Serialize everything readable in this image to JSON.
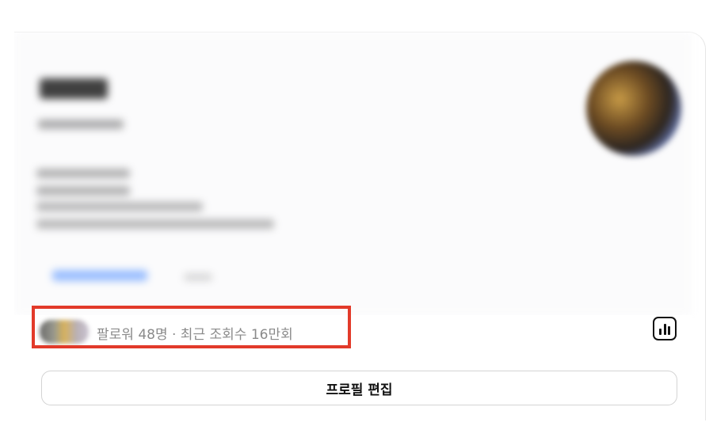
{
  "profile": {
    "stats_text": "팔로워 48명 · 최근 조회수 16만회",
    "edit_button_label": "프로필 편집"
  },
  "icons": {
    "insights": "bar-chart-icon",
    "follower_avatars": "follower-avatar-stack"
  },
  "colors": {
    "highlight": "#e23a2a",
    "stats_text": "#8a8a8a",
    "button_border": "#d4d4d4"
  }
}
